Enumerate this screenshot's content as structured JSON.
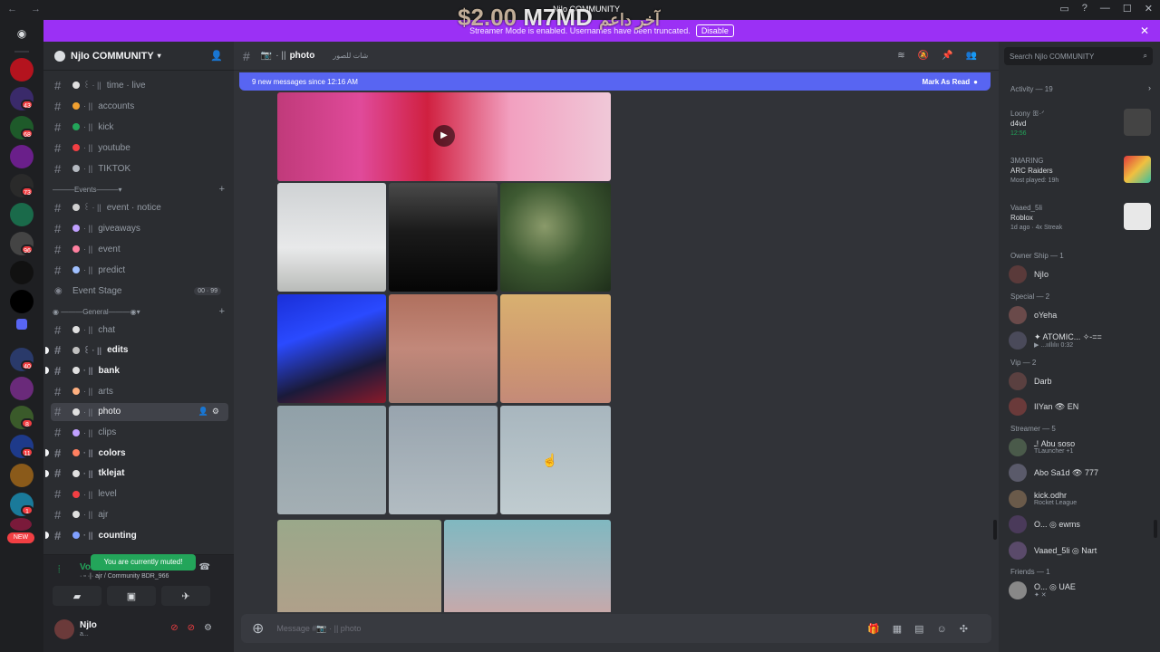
{
  "overlay": {
    "price": "$2.00",
    "name": "M7MD",
    "arabic": "آخر داعم",
    "small": "NjIo COMMUNITY"
  },
  "banner": {
    "text": "Streamer Mode is enabled. Usernames have been truncated.",
    "button": "Disable"
  },
  "guild_badges": [
    "43",
    "68",
    "73",
    "96",
    "40",
    "8",
    "11",
    "1",
    "1"
  ],
  "guild_new": "NEW",
  "server": {
    "name": "NjIo COMMUNITY"
  },
  "channels": [
    {
      "label": "time · live",
      "bars": "꒰ · ||",
      "dot": "#e0e0e0",
      "unread": false
    },
    {
      "label": "accounts",
      "bars": "· ||",
      "dot": "#f0a030",
      "unread": false
    },
    {
      "label": "kick",
      "bars": "· ||",
      "dot": "#23a55a",
      "unread": false
    },
    {
      "label": "youtube",
      "bars": "· ||",
      "dot": "#f23f43",
      "unread": false
    },
    {
      "label": "TIKTOK",
      "bars": "· ||",
      "dot": "#b5bac1",
      "unread": false
    }
  ],
  "events_category": "Events",
  "event_channels": [
    {
      "label": "event · notice",
      "bars": "꒰ · ||",
      "dot": "#d0d0d0"
    },
    {
      "label": "giveaways",
      "bars": "· ||",
      "dot": "#c0a0ff"
    },
    {
      "label": "event",
      "bars": "· ||",
      "dot": "#ff80a0"
    },
    {
      "label": "predict",
      "bars": "· ||",
      "dot": "#a0c0ff"
    }
  ],
  "stage": {
    "label": "Event Stage",
    "tag": "00 · 99"
  },
  "general_category": "General",
  "general_channels": [
    {
      "label": "chat",
      "bars": "· ||",
      "dot": "#e0e0e0",
      "unread": false
    },
    {
      "label": "edits",
      "bars": "꒰ · ||",
      "dot": "#c0c0c0",
      "unread": true
    },
    {
      "label": "bank",
      "bars": "· ||",
      "dot": "#e0e0e0",
      "unread": true
    },
    {
      "label": "arts",
      "bars": "· ||",
      "dot": "#ffb080",
      "unread": false
    },
    {
      "label": "photo",
      "bars": "· ||",
      "dot": "#e0e0e0",
      "unread": false,
      "active": true
    },
    {
      "label": "clips",
      "bars": "· ||",
      "dot": "#c0a0ff",
      "unread": false
    },
    {
      "label": "colors",
      "bars": "· ||",
      "dot": "#ff8060",
      "unread": true
    },
    {
      "label": "tklejat",
      "bars": "· ||",
      "dot": "#e0e0e0",
      "unread": true
    },
    {
      "label": "level",
      "bars": "· ||",
      "dot": "#f23f43",
      "unread": false
    },
    {
      "label": "ajr",
      "bars": "· ||",
      "dot": "#e0e0e0",
      "unread": false
    },
    {
      "label": "counting",
      "bars": "· ||",
      "dot": "#80a0ff",
      "unread": true
    }
  ],
  "voice": {
    "title": "Voice Connected",
    "sub": "· ▫ ·|· ajr / Community BDR_966",
    "muted_tip": "You are currently muted!"
  },
  "me": {
    "name": "NjIo",
    "sub": "a..."
  },
  "chat": {
    "channel": "photo",
    "bars": "· ||",
    "topic": "شات للصور",
    "new_messages": "9 new messages since 12:16 AM",
    "mark_read": "Mark As Read",
    "composer_placeholder": "Message #📷 · || photo"
  },
  "members": {
    "search_placeholder": "Search NjIo COMMUNITY",
    "activity_title": "Activity — 19",
    "activities": [
      {
        "name": "Loony ꕥ·ᐟ",
        "line1": "d4vd",
        "line2": "12:56"
      },
      {
        "name": "3MARING",
        "line1": "ARC Raiders",
        "line2": "Most played: 19h"
      },
      {
        "name": "Vaaed_5li",
        "line1": "Roblox",
        "line2": "1d ago · 4x Streak"
      }
    ],
    "groups": [
      {
        "title": "Owner Ship — 1",
        "members": [
          {
            "name": "NjIo",
            "sub": ""
          }
        ]
      },
      {
        "title": "Special — 2",
        "members": [
          {
            "name": "oYeha",
            "sub": ""
          },
          {
            "name": "✦ ATOMIC... ✧-==",
            "sub": "▶ ...ııllılıı 0:32"
          }
        ]
      },
      {
        "title": "Vip — 2",
        "members": [
          {
            "name": "Darb",
            "sub": ""
          },
          {
            "name": "IIYan 👁 EN",
            "sub": ""
          }
        ]
      },
      {
        "title": "Streamer — 5",
        "members": [
          {
            "name": "ـ! Abu soso",
            "sub": "TLauncher +1"
          },
          {
            "name": "Abo Sa1d 👁 777",
            "sub": ""
          },
          {
            "name": "kick.odhr",
            "sub": "Rocket League"
          },
          {
            "name": "O... ◎ ewms",
            "sub": ""
          },
          {
            "name": "Vaaed_5li ◎ Nart",
            "sub": ""
          }
        ]
      },
      {
        "title": "Friends — 1",
        "members": [
          {
            "name": "O... ◎ UAE",
            "sub": "✦ ✕"
          }
        ]
      }
    ]
  },
  "colors": {
    "accent": "#5865f2",
    "banner": "#9b30f5",
    "online": "#23a55a",
    "danger": "#f23f43"
  }
}
